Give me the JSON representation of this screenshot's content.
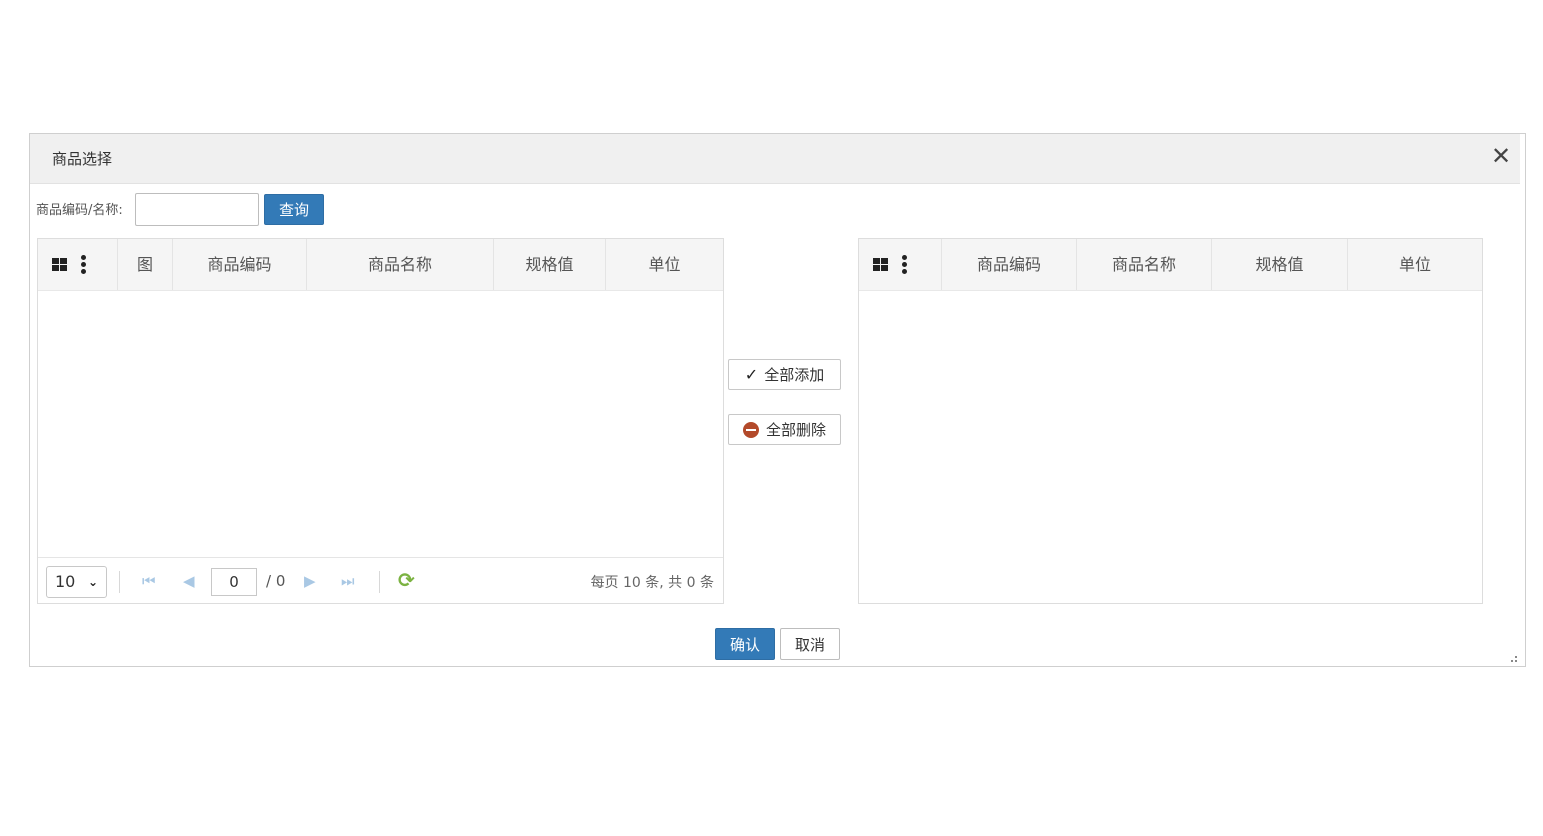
{
  "dialog": {
    "title": "商品选择",
    "close_icon": "close-icon"
  },
  "search": {
    "label": "商品编码/名称:",
    "value": "",
    "placeholder": "",
    "query_label": "查询"
  },
  "left_grid": {
    "columns": [
      "图",
      "商品编码",
      "商品名称",
      "规格值",
      "单位"
    ],
    "rows": [],
    "pager": {
      "page_size": "10",
      "current_page": "0",
      "total_pages": "/ 0",
      "info": "每页 10 条, 共 0 条"
    }
  },
  "right_grid": {
    "columns": [
      "商品编码",
      "商品名称",
      "规格值",
      "单位"
    ],
    "rows": []
  },
  "actions": {
    "add_all_label": "全部添加",
    "delete_all_label": "全部删除"
  },
  "footer": {
    "confirm_label": "确认",
    "cancel_label": "取消"
  },
  "colors": {
    "primary": "#337ab7",
    "header_bg": "#f0f0f0",
    "delete_icon": "#b34a2a",
    "refresh_icon": "#7cb342"
  }
}
